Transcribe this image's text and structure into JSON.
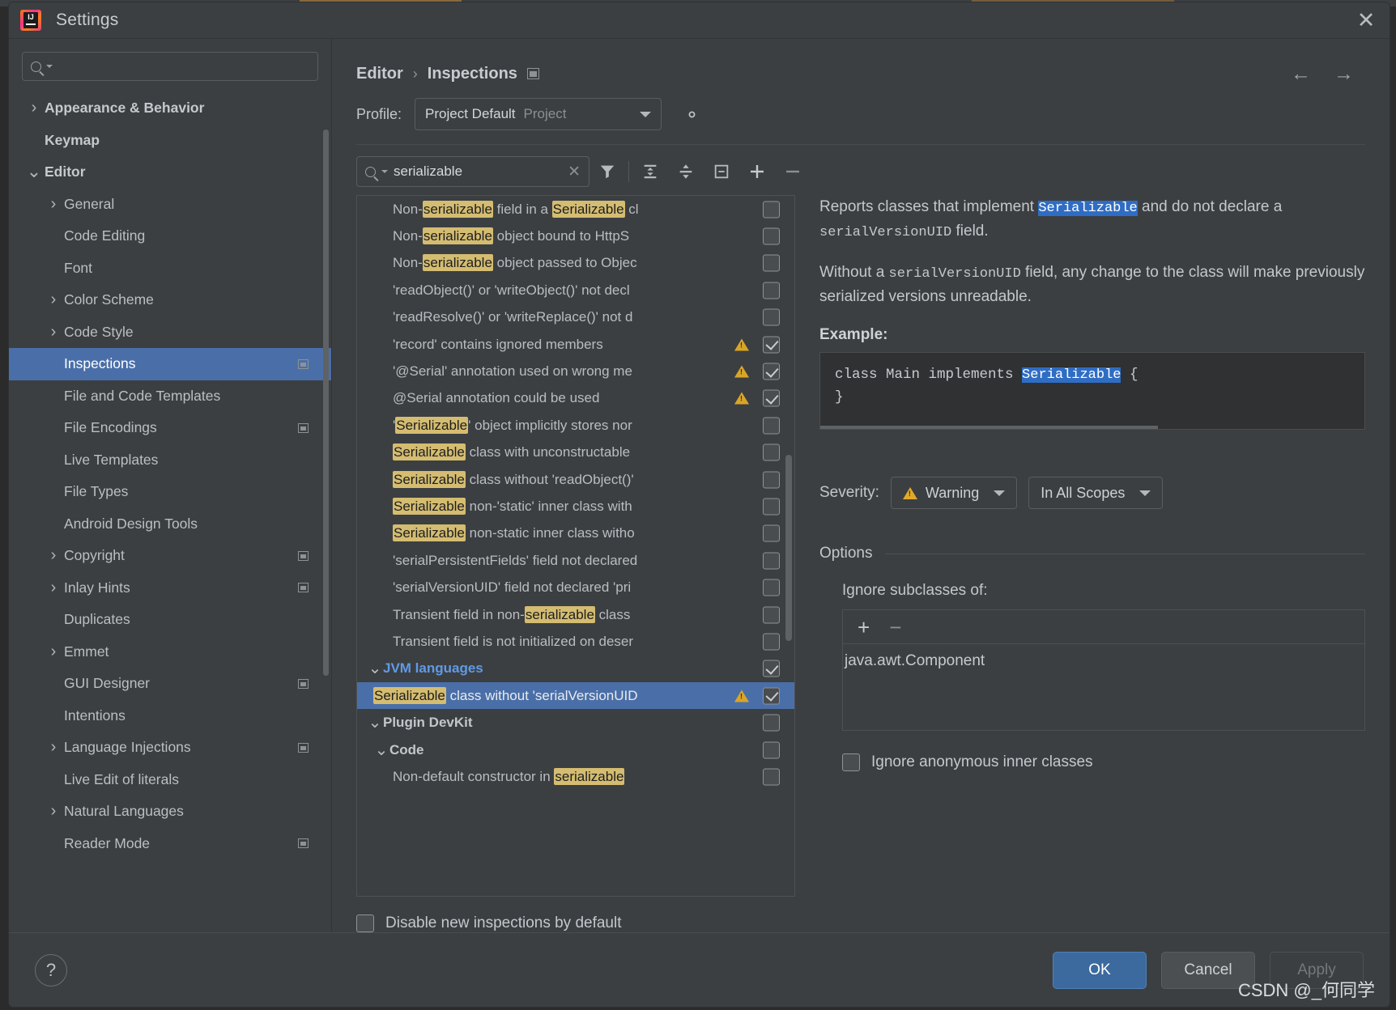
{
  "window": {
    "title": "Settings",
    "logo_icon": "intellij-idea-logo",
    "close_icon": "close-icon"
  },
  "sidebar": {
    "search": {
      "placeholder": "",
      "value": "",
      "icon": "search-icon"
    },
    "items": [
      {
        "label": "Appearance & Behavior",
        "arrow": "›",
        "level": 0,
        "bold": true,
        "selected": false,
        "mini": false
      },
      {
        "label": "Keymap",
        "arrow": "",
        "level": 0,
        "bold": true,
        "selected": false,
        "mini": false
      },
      {
        "label": "Editor",
        "arrow": "ˇ",
        "level": 0,
        "bold": true,
        "selected": false,
        "mini": false
      },
      {
        "label": "General",
        "arrow": "›",
        "level": 1,
        "bold": false,
        "selected": false,
        "mini": false
      },
      {
        "label": "Code Editing",
        "arrow": "",
        "level": 1,
        "bold": false,
        "selected": false,
        "mini": false
      },
      {
        "label": "Font",
        "arrow": "",
        "level": 1,
        "bold": false,
        "selected": false,
        "mini": false
      },
      {
        "label": "Color Scheme",
        "arrow": "›",
        "level": 1,
        "bold": false,
        "selected": false,
        "mini": false
      },
      {
        "label": "Code Style",
        "arrow": "›",
        "level": 1,
        "bold": false,
        "selected": false,
        "mini": false
      },
      {
        "label": "Inspections",
        "arrow": "",
        "level": 1,
        "bold": false,
        "selected": true,
        "mini": true
      },
      {
        "label": "File and Code Templates",
        "arrow": "",
        "level": 1,
        "bold": false,
        "selected": false,
        "mini": false
      },
      {
        "label": "File Encodings",
        "arrow": "",
        "level": 1,
        "bold": false,
        "selected": false,
        "mini": true
      },
      {
        "label": "Live Templates",
        "arrow": "",
        "level": 1,
        "bold": false,
        "selected": false,
        "mini": false
      },
      {
        "label": "File Types",
        "arrow": "",
        "level": 1,
        "bold": false,
        "selected": false,
        "mini": false
      },
      {
        "label": "Android Design Tools",
        "arrow": "",
        "level": 1,
        "bold": false,
        "selected": false,
        "mini": false
      },
      {
        "label": "Copyright",
        "arrow": "›",
        "level": 1,
        "bold": false,
        "selected": false,
        "mini": true
      },
      {
        "label": "Inlay Hints",
        "arrow": "›",
        "level": 1,
        "bold": false,
        "selected": false,
        "mini": true
      },
      {
        "label": "Duplicates",
        "arrow": "",
        "level": 1,
        "bold": false,
        "selected": false,
        "mini": false
      },
      {
        "label": "Emmet",
        "arrow": "›",
        "level": 1,
        "bold": false,
        "selected": false,
        "mini": false
      },
      {
        "label": "GUI Designer",
        "arrow": "",
        "level": 1,
        "bold": false,
        "selected": false,
        "mini": true
      },
      {
        "label": "Intentions",
        "arrow": "",
        "level": 1,
        "bold": false,
        "selected": false,
        "mini": false
      },
      {
        "label": "Language Injections",
        "arrow": "›",
        "level": 1,
        "bold": false,
        "selected": false,
        "mini": true
      },
      {
        "label": "Live Edit of literals",
        "arrow": "",
        "level": 1,
        "bold": false,
        "selected": false,
        "mini": false
      },
      {
        "label": "Natural Languages",
        "arrow": "›",
        "level": 1,
        "bold": false,
        "selected": false,
        "mini": false
      },
      {
        "label": "Reader Mode",
        "arrow": "",
        "level": 1,
        "bold": false,
        "selected": false,
        "mini": true
      }
    ]
  },
  "breadcrumb": {
    "parent": "Editor",
    "separator": "›",
    "current": "Inspections",
    "icon": "window-icon",
    "back_arrow": "←",
    "forward_arrow": "→"
  },
  "profile": {
    "label": "Profile:",
    "name": "Project Default",
    "kind": "Project",
    "gear_icon": "gear-icon"
  },
  "filter_bar": {
    "search_value": "serializable",
    "search_icon": "search-icon",
    "clear_icon": "clear-icon",
    "icons": [
      "filter-icon",
      "expand-all-icon",
      "collapse-all-icon",
      "collapse-icon",
      "add-icon",
      "remove-icon"
    ]
  },
  "inspections": [
    {
      "indent": 2,
      "type": "item",
      "pre": "Non-",
      "hl1": "serializable",
      "mid": " field in a ",
      "hl2": "Serializable",
      "post": " cl",
      "warn": false,
      "checked": false,
      "selected": false
    },
    {
      "indent": 2,
      "type": "item",
      "pre": "Non-",
      "hl1": "serializable",
      "mid": " object bound to HttpS",
      "hl2": "",
      "post": "",
      "warn": false,
      "checked": false,
      "selected": false
    },
    {
      "indent": 2,
      "type": "item",
      "pre": "Non-",
      "hl1": "serializable",
      "mid": " object passed to Objec",
      "hl2": "",
      "post": "",
      "warn": false,
      "checked": false,
      "selected": false
    },
    {
      "indent": 2,
      "type": "item",
      "pre": "'readObject()' or 'writeObject()' not decl",
      "hl1": "",
      "mid": "",
      "hl2": "",
      "post": "",
      "warn": false,
      "checked": false,
      "selected": false
    },
    {
      "indent": 2,
      "type": "item",
      "pre": "'readResolve()' or 'writeReplace()' not d",
      "hl1": "",
      "mid": "",
      "hl2": "",
      "post": "",
      "warn": false,
      "checked": false,
      "selected": false
    },
    {
      "indent": 2,
      "type": "item",
      "pre": "'record' contains ignored members",
      "hl1": "",
      "mid": "",
      "hl2": "",
      "post": "",
      "warn": true,
      "checked": true,
      "selected": false
    },
    {
      "indent": 2,
      "type": "item",
      "pre": "'@Serial' annotation used on wrong me",
      "hl1": "",
      "mid": "",
      "hl2": "",
      "post": "",
      "warn": true,
      "checked": true,
      "selected": false
    },
    {
      "indent": 2,
      "type": "item",
      "pre": "@Serial annotation could be used",
      "hl1": "",
      "mid": "",
      "hl2": "",
      "post": "",
      "warn": true,
      "checked": true,
      "selected": false
    },
    {
      "indent": 2,
      "type": "item",
      "pre": "'",
      "hl1": "Serializable",
      "mid": "' object implicitly stores nor",
      "hl2": "",
      "post": "",
      "warn": false,
      "checked": false,
      "selected": false
    },
    {
      "indent": 2,
      "type": "item",
      "pre": "",
      "hl1": "Serializable",
      "mid": " class with unconstructable ",
      "hl2": "",
      "post": "",
      "warn": false,
      "checked": false,
      "selected": false
    },
    {
      "indent": 2,
      "type": "item",
      "pre": "",
      "hl1": "Serializable",
      "mid": " class without 'readObject()'",
      "hl2": "",
      "post": "",
      "warn": false,
      "checked": false,
      "selected": false
    },
    {
      "indent": 2,
      "type": "item",
      "pre": "",
      "hl1": "Serializable",
      "mid": " non-'static' inner class with",
      "hl2": "",
      "post": "",
      "warn": false,
      "checked": false,
      "selected": false
    },
    {
      "indent": 2,
      "type": "item",
      "pre": "",
      "hl1": "Serializable",
      "mid": " non-static inner class witho",
      "hl2": "",
      "post": "",
      "warn": false,
      "checked": false,
      "selected": false
    },
    {
      "indent": 2,
      "type": "item",
      "pre": "'serialPersistentFields' field not declared",
      "hl1": "",
      "mid": "",
      "hl2": "",
      "post": "",
      "warn": false,
      "checked": false,
      "selected": false
    },
    {
      "indent": 2,
      "type": "item",
      "pre": "'serialVersionUID' field not declared 'pri",
      "hl1": "",
      "mid": "",
      "hl2": "",
      "post": "",
      "warn": false,
      "checked": false,
      "selected": false
    },
    {
      "indent": 2,
      "type": "item",
      "pre": "Transient field in non-",
      "hl1": "serializable",
      "mid": " class",
      "hl2": "",
      "post": "",
      "warn": false,
      "checked": false,
      "selected": false
    },
    {
      "indent": 2,
      "type": "item",
      "pre": "Transient field is not initialized on deser",
      "hl1": "",
      "mid": "",
      "hl2": "",
      "post": "",
      "warn": false,
      "checked": false,
      "selected": false
    },
    {
      "indent": 0,
      "type": "group_blue",
      "pre": "JVM languages",
      "hl1": "",
      "mid": "",
      "hl2": "",
      "post": "",
      "warn": false,
      "checked": true,
      "selected": false
    },
    {
      "indent": 1,
      "type": "item",
      "pre": "",
      "hl1": "Serializable",
      "mid": " class without 'serialVersionUID",
      "hl2": "",
      "post": "",
      "warn": true,
      "checked": true,
      "selected": true
    },
    {
      "indent": 0,
      "type": "group_grey",
      "pre": "Plugin DevKit",
      "hl1": "",
      "mid": "",
      "hl2": "",
      "post": "",
      "warn": false,
      "checked": false,
      "selected": false
    },
    {
      "indent": 1,
      "type": "group_grey",
      "pre": "Code",
      "hl1": "",
      "mid": "",
      "hl2": "",
      "post": "",
      "warn": false,
      "checked": false,
      "selected": false
    },
    {
      "indent": 2,
      "type": "item",
      "pre": "Non-default constructor in ",
      "hl1": "serializable",
      "mid": " ",
      "hl2": "",
      "post": "",
      "warn": false,
      "checked": false,
      "selected": false
    }
  ],
  "disable_new": {
    "label": "Disable new inspections by default",
    "checked": false
  },
  "description": {
    "p1_a": "Reports classes that implement ",
    "p1_hl": "Serializable",
    "p1_b": " and do not declare a ",
    "p1_mono": "serialVersionUID",
    "p1_c": " field.",
    "p2_a": "Without a ",
    "p2_mono": "serialVersionUID",
    "p2_b": " field, any change to the class will make previously serialized versions unreadable.",
    "example_title": "Example:",
    "code_line1_a": "class Main implements ",
    "code_line1_hl": "Serializable",
    "code_line1_b": " {",
    "code_line2": "}"
  },
  "severity": {
    "label": "Severity:",
    "value": "Warning",
    "warn_icon": "warning-triangle-icon",
    "scope": "In All Scopes",
    "caret_icon": "chevron-down-icon"
  },
  "options": {
    "title": "Options",
    "sub_label": "Ignore subclasses of:",
    "add_icon": "plus-icon",
    "remove_icon": "minus-icon",
    "items": [
      "java.awt.Component"
    ],
    "anon_checkbox_label": "Ignore anonymous inner classes",
    "anon_checked": false
  },
  "footer": {
    "help_icon": "help-icon",
    "ok": "OK",
    "cancel": "Cancel",
    "apply": "Apply"
  },
  "watermark": "CSDN @_何同学",
  "colors": {
    "accent_blue": "#4a6fa8",
    "highlight_yellow": "#d4bc71",
    "warning_orange": "#d9a528",
    "group_blue": "#5f9ae8",
    "selection_blue": "#2f6dc4"
  }
}
